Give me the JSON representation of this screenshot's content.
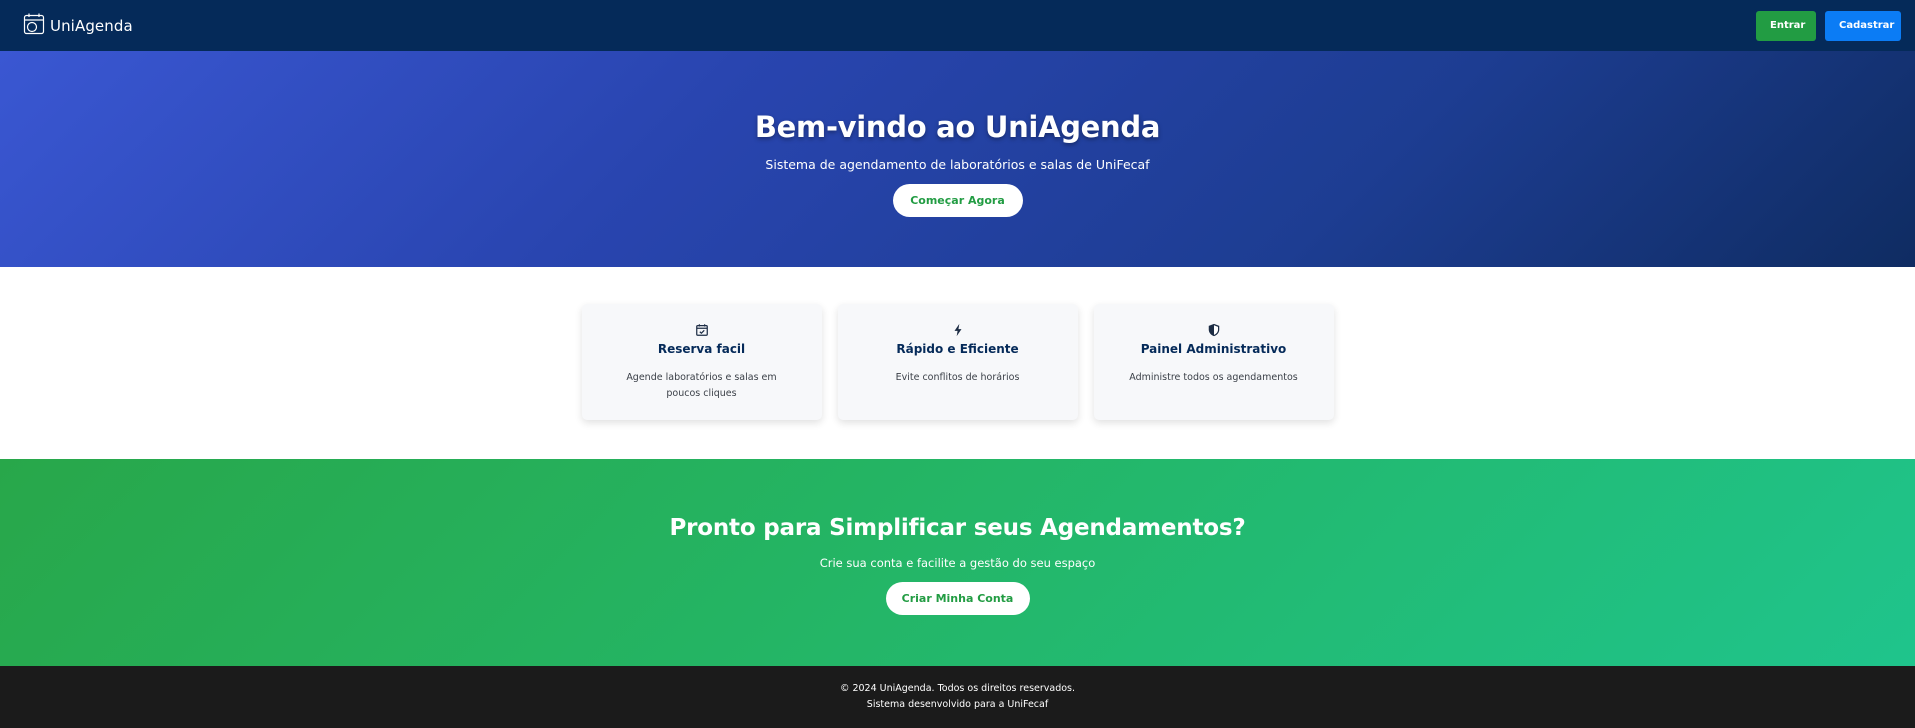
{
  "navbar": {
    "brand": "UniAgenda",
    "login_label": "Entrar",
    "register_label": "Cadastrar"
  },
  "hero": {
    "title": "Bem-vindo ao UniAgenda",
    "subtitle": "Sistema de agendamento de laboratórios e salas de UniFecaf",
    "cta_label": "Começar Agora"
  },
  "features": [
    {
      "icon": "calendar-check-icon",
      "title": "Reserva facil",
      "description": "Agende laboratórios e salas em poucos cliques"
    },
    {
      "icon": "lightning-bolt-icon",
      "title": "Rápido e Eficiente",
      "description": "Evite conflitos de horários"
    },
    {
      "icon": "shield-icon",
      "title": "Painel Administrativo",
      "description": "Administre todos os agendamentos"
    }
  ],
  "cta": {
    "title": "Pronto para Simplificar seus Agendamentos?",
    "subtitle": "Crie sua conta e facilite a gestão do seu espaço",
    "button_label": "Criar Minha Conta"
  },
  "footer": {
    "copyright": "© 2024 UniAgenda. Todos os direitos reservados.",
    "credit": "Sistema desenvolvido para a UniFecaf"
  },
  "colors": {
    "navbar": "#052a59",
    "login_button": "#229c43",
    "register_button": "#0b7cf5",
    "accent_green": "#229c43",
    "footer": "#1b1b1b"
  }
}
